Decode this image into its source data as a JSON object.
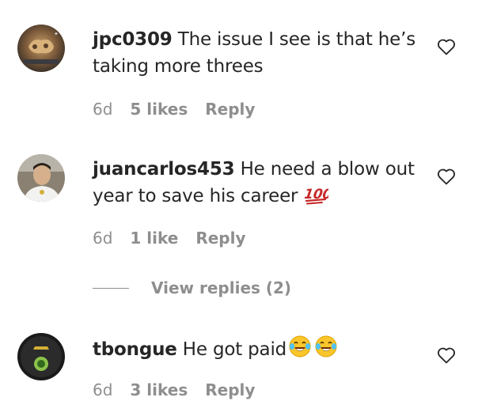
{
  "comments": [
    {
      "username": "jpc0309",
      "text": "The issue I see is that he’s taking more threes",
      "time": "6d",
      "likes": "5 likes",
      "reply": "Reply"
    },
    {
      "username": "juancarlos453",
      "text": "He need a blow out year to save his career ",
      "emoji": "hundred-points-icon",
      "time": "6d",
      "likes": "1 like",
      "reply": "Reply"
    },
    {
      "username": "tbongue",
      "text": "He got paid",
      "emoji": "face-with-tears-of-joy-icon",
      "time": "6d",
      "likes": "3 likes",
      "reply": "Reply"
    }
  ],
  "view_replies": "View replies (2)"
}
